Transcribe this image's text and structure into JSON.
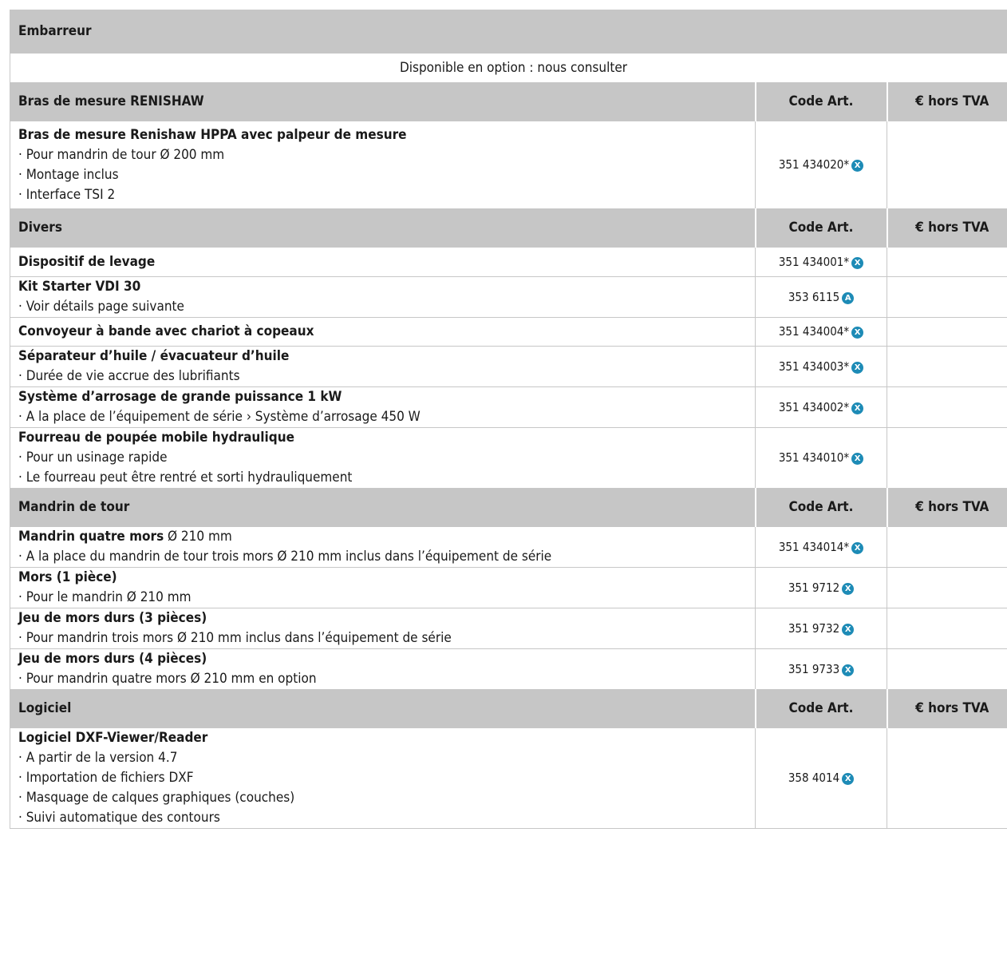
{
  "colors": {
    "header_bg": "#c6c6c6",
    "grid": "#c7c7c7",
    "mark": "#1d8bb6"
  },
  "top_header": "Embarreur",
  "option_note": "Disponible en option : nous consulter",
  "sections": [
    {
      "header": "Bras de mesure RENISHAW",
      "code_header": "Code Art.",
      "price_header": "€ hors TVA",
      "items": [
        {
          "title": "Bras de mesure Renishaw HPPA avec palpeur de mesure",
          "bullets": [
            " Pour mandrin de tour Ø 200 mm",
            "Montage inclus",
            "Interface TSI 2"
          ],
          "code": "351 434020*",
          "mark": "X"
        }
      ]
    },
    {
      "header": "Divers",
      "code_header": "Code Art.",
      "price_header": "€ hors TVA",
      "items": [
        {
          "title": "Dispositif de levage",
          "bullets": [],
          "code": "351 434001*",
          "mark": "X"
        },
        {
          "title": "Kit Starter VDI 30",
          "bullets": [
            "Voir détails page suivante"
          ],
          "code": "353 6115",
          "mark": "A"
        },
        {
          "title": "Convoyeur à bande avec chariot à copeaux",
          "bullets": [],
          "code": "351 434004*",
          "mark": "X"
        },
        {
          "title": "Séparateur d’huile / évacuateur d’huile",
          "bullets": [
            "Durée de vie accrue des lubrifiants"
          ],
          "code": "351 434003*",
          "mark": "X"
        },
        {
          "title": "Système d’arrosage de grande puissance 1 kW",
          "bullets": [
            "A la place de l’équipement de série › Système d’arrosage 450 W"
          ],
          "code": "351 434002*",
          "mark": "X"
        },
        {
          "title": "Fourreau de poupée mobile hydraulique",
          "bullets": [
            "Pour un usinage rapide",
            "Le fourreau peut être rentré et sorti hydrauliquement"
          ],
          "code": "351 434010*",
          "mark": "X"
        }
      ]
    },
    {
      "header": "Mandrin de tour",
      "code_header": "Code Art.",
      "price_header": "€ hors TVA",
      "items": [
        {
          "title": "Mandrin quatre mors",
          "title_suffix": " Ø 210 mm",
          "bullets": [
            "A la place du mandrin de tour trois mors Ø 210 mm inclus dans l’équipement de série"
          ],
          "code": "351 434014*",
          "mark": "X"
        },
        {
          "title": "Mors (1 pièce)",
          "bullets": [
            "Pour le mandrin Ø 210 mm"
          ],
          "code": "351 9712",
          "mark": "X"
        },
        {
          "title": "Jeu de mors durs (3 pièces)",
          "bullets": [
            "Pour mandrin trois mors Ø 210 mm inclus dans l’équipement de série"
          ],
          "code": "351 9732",
          "mark": "X"
        },
        {
          "title": "Jeu de mors durs (4 pièces)",
          "bullets": [
            "Pour mandrin quatre mors Ø 210 mm en option"
          ],
          "code": "351 9733",
          "mark": "X"
        }
      ]
    },
    {
      "header": "Logiciel",
      "code_header": "Code Art.",
      "price_header": "€ hors TVA",
      "items": [
        {
          "title": "Logiciel DXF-Viewer/Reader",
          "bullets": [
            "A partir de la version 4.7",
            "Importation de fichiers DXF",
            "Masquage de calques graphiques (couches)",
            "Suivi automatique des contours"
          ],
          "code": "358 4014",
          "mark": "X"
        }
      ]
    }
  ]
}
